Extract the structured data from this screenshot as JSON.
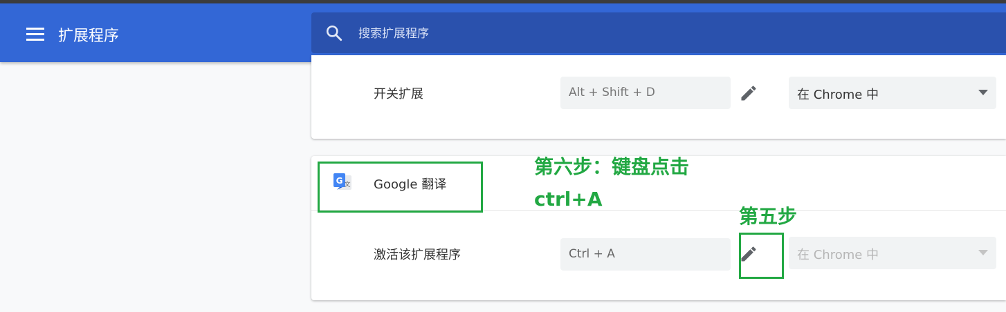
{
  "header": {
    "title": "扩展程序",
    "search_placeholder": "搜索扩展程序",
    "accent_color": "#3367d6"
  },
  "shortcut_rows": [
    {
      "label": "开关扩展",
      "shortcut": "Alt + Shift + D",
      "scope": "在 Chrome 中",
      "scope_enabled": true
    }
  ],
  "extension": {
    "name": "Google 翻译",
    "icon": "google-translate-icon",
    "row": {
      "label": "激活该扩展程序",
      "shortcut": "Ctrl + A",
      "scope": "在 Chrome 中",
      "scope_enabled": false
    }
  },
  "annotations": {
    "step6_line1": "第六步：键盘点击",
    "step6_line2": "ctrl+A",
    "step5": "第五步",
    "color": "#22a843"
  }
}
